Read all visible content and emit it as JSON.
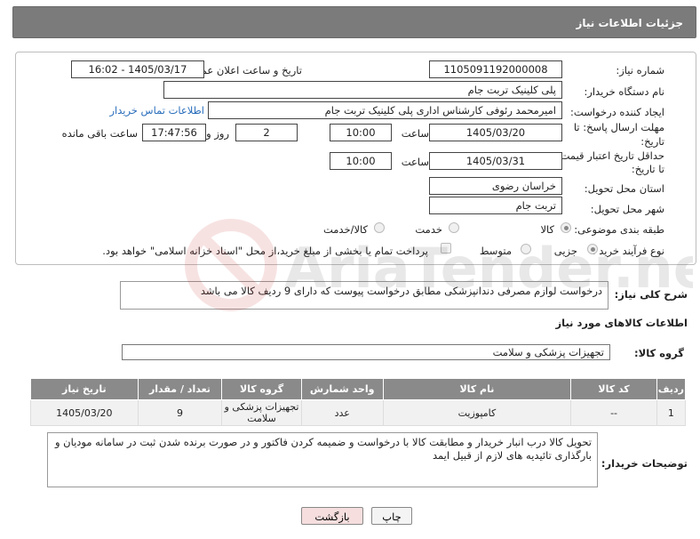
{
  "header": {
    "title": "جزئیات اطلاعات نیاز"
  },
  "form": {
    "need_number_label": "شماره نیاز:",
    "need_number": "1105091192000008",
    "announce_label": "تاریخ و ساعت اعلان عمومی:",
    "announce_value": "1405/03/17 - 16:02",
    "buyer_org_label": "نام دستگاه خریدار:",
    "buyer_org": "پلی کلینیک تربت جام",
    "requester_label": "ایجاد کننده درخواست:",
    "requester": "امیرمحمد رئوفی کارشناس اداری پلی کلینیک تربت جام",
    "contact_link": "اطلاعات تماس خریدار",
    "deadline_label_1": "مهلت ارسال پاسخ: تا",
    "deadline_label_2": "تاریخ:",
    "deadline_date": "1405/03/20",
    "hour_label": "ساعت",
    "deadline_time": "10:00",
    "days_value": "2",
    "days_label": "روز و",
    "remaining_time": "17:47:56",
    "remaining_label": "ساعت باقی مانده",
    "validity_label_1": "حداقل تاریخ اعتبار قیمت:",
    "validity_label_2": "تا تاریخ:",
    "validity_date": "1405/03/31",
    "validity_time": "10:00",
    "province_label": "استان محل تحویل:",
    "province": "خراسان رضوی",
    "city_label": "شهر محل تحویل:",
    "city": "تربت جام",
    "category_label": "طبقه بندی موضوعی:",
    "category_options": [
      "کالا",
      "خدمت",
      "کالا/خدمت"
    ],
    "process_label": "نوع فرآیند خرید :",
    "process_options": [
      "جزیی",
      "متوسط"
    ],
    "payment_note": "پرداخت تمام یا بخشی از مبلغ خرید،از محل \"اسناد خزانه اسلامی\" خواهد بود."
  },
  "summary": {
    "label": "شرح کلی نیاز:",
    "text": "درخواست لوازم مصرفی دندانپزشکی مطابق درخواست پیوست که دارای 9 ردیف کالا می باشد"
  },
  "goods": {
    "section_title": "اطلاعات کالاهای مورد نیاز",
    "group_label": "گروه کالا:",
    "group_value": "تجهیزات پزشکی و سلامت",
    "columns": [
      "ردیف",
      "کد کالا",
      "نام کالا",
      "واحد شمارش",
      "گروه کالا",
      "تعداد / مقدار",
      "تاریخ نیاز"
    ],
    "rows": [
      {
        "row": "1",
        "code": "--",
        "name": "کامپوزیت",
        "unit": "عدد",
        "group": "تجهیزات پزشکی و سلامت",
        "qty": "9",
        "date": "1405/03/20"
      }
    ]
  },
  "notes": {
    "label": "توضیحات خریدار:",
    "text": "تحویل کالا درب انبار خریدار و مطابقت کالا با درخواست و ضمیمه کردن فاکتور و در صورت برنده شدن ثبت در سامانه مودیان و بارگذاری تائیدیه های لازم از قبیل ایمد"
  },
  "buttons": {
    "print": "چاپ",
    "back": "بازگشت"
  },
  "watermark": {
    "text": "AriaTender.net"
  },
  "colors": {
    "header_bg": "#7b7b7b",
    "table_header_bg": "#8a8a8a",
    "link": "#2a6ebb",
    "back_button_bg": "#f6dede"
  }
}
